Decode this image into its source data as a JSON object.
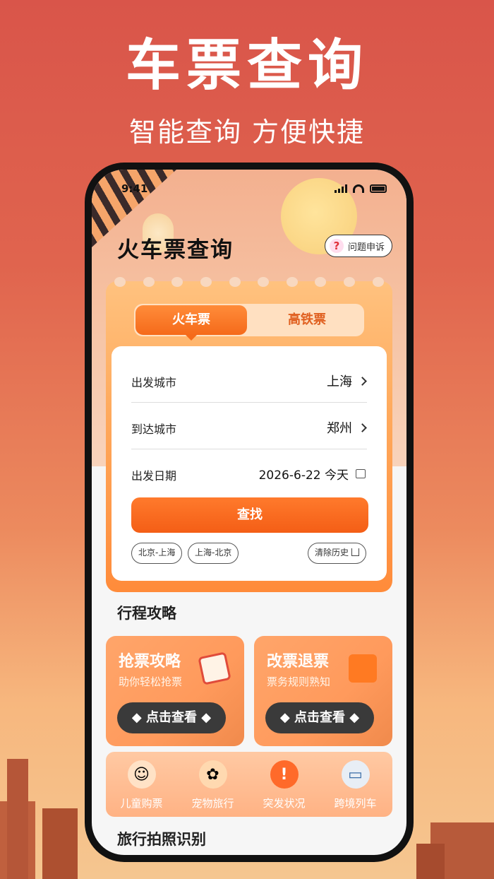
{
  "promo": {
    "title": "车票查询",
    "subtitle": "智能查询 方便快捷"
  },
  "status_bar": {
    "time": "9:41"
  },
  "app": {
    "title": "火车票查询",
    "help_label": "问题申诉"
  },
  "tabs": [
    {
      "label": "火车票",
      "active": true
    },
    {
      "label": "高铁票",
      "active": false
    }
  ],
  "form": {
    "departure": {
      "label": "出发城市",
      "value": "上海"
    },
    "arrival": {
      "label": "到达城市",
      "value": "郑州"
    },
    "date": {
      "label": "出发日期",
      "value": "2026-6-22 今天"
    },
    "search_label": "查找",
    "history": [
      "北京-上海",
      "上海-北京"
    ],
    "clear_history_label": "清除历史"
  },
  "guides_section": {
    "title": "行程攻略",
    "cards": [
      {
        "title": "抢票攻略",
        "subtitle": "助你轻松抢票",
        "button": "◆ 点击查看 ◆"
      },
      {
        "title": "改票退票",
        "subtitle": "票务规则熟知",
        "button": "◆ 点击查看 ◆"
      }
    ]
  },
  "quick_links": [
    {
      "label": "儿童购票",
      "icon": "child-icon"
    },
    {
      "label": "宠物旅行",
      "icon": "cat-icon"
    },
    {
      "label": "突发状况",
      "icon": "alert-icon"
    },
    {
      "label": "跨境列车",
      "icon": "train-icon"
    }
  ],
  "photo_section": {
    "title": "旅行拍照识别"
  },
  "colors": {
    "accent": "#f45e16",
    "tab_bg": "#ffe0c1",
    "button_dark": "#3a3a3a"
  }
}
